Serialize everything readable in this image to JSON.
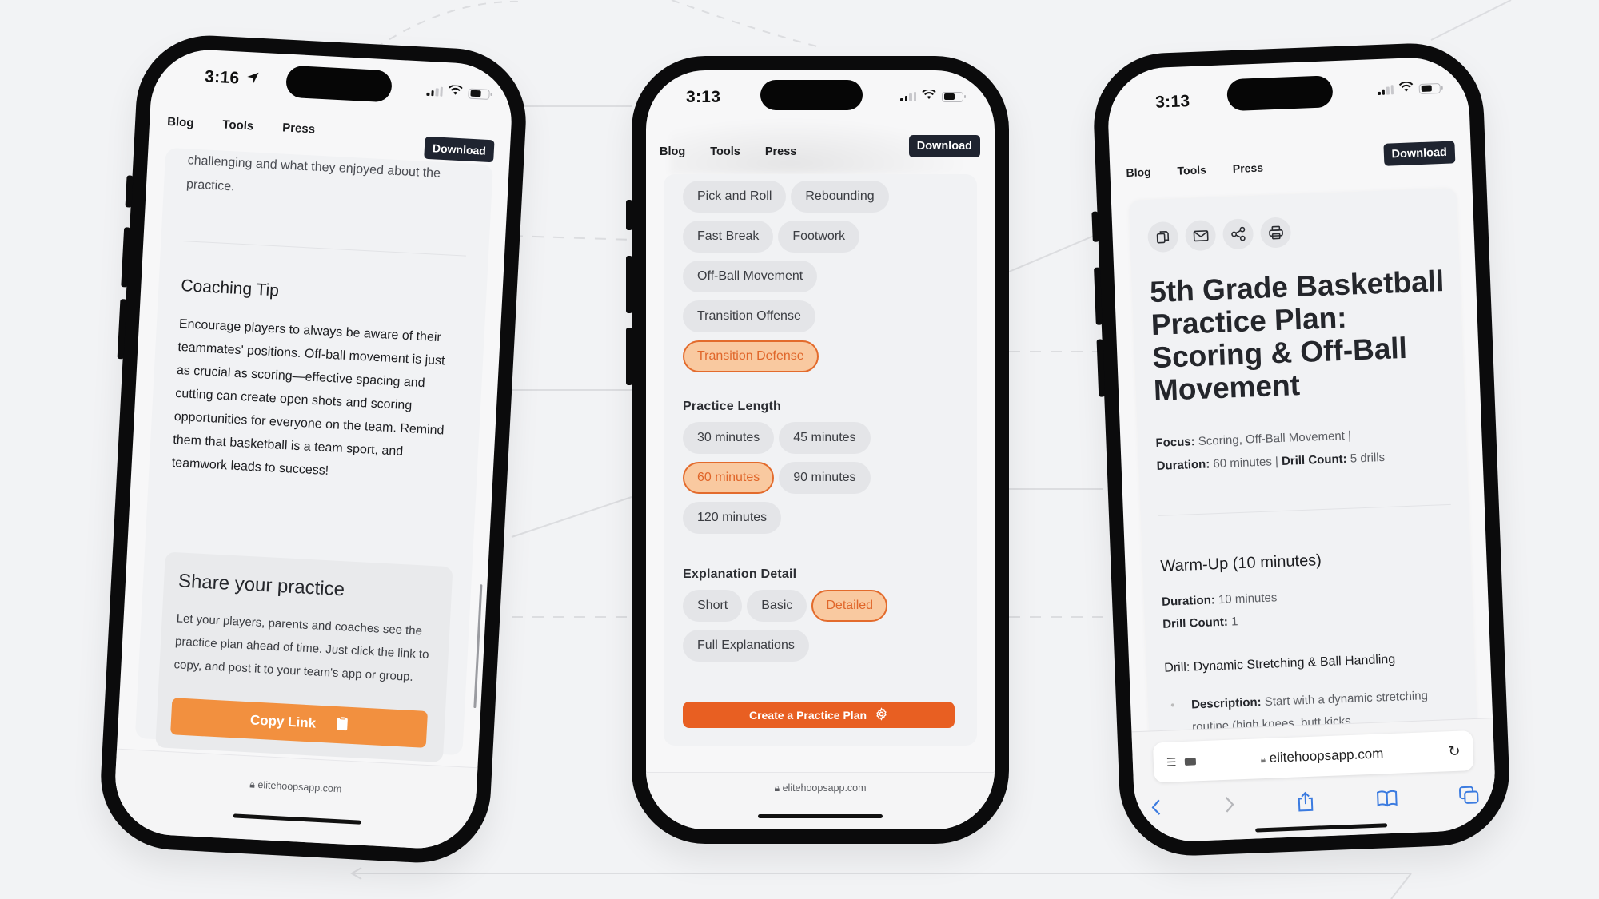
{
  "colors": {
    "accent_orange": "#e85f22",
    "copy_orange": "#f2903f",
    "chip_selected_bg": "#f9c9a0",
    "chip_selected_text": "#e0662a",
    "dark_button": "#1f2430",
    "ios_blue": "#3b7be0"
  },
  "nav": {
    "blog": "Blog",
    "tools": "Tools",
    "press": "Press",
    "download": "Download"
  },
  "url": "elitehoopsapp.com",
  "phone_left": {
    "time": "3:16",
    "location_icon": "location-arrow-icon",
    "intro_text": "challenging and what they enjoyed about the practice.",
    "coaching_tip": {
      "title": "Coaching Tip",
      "body": "Encourage players to always be aware of their teammates' positions. Off-ball movement is just as crucial as scoring—effective spacing and cutting can create open shots and scoring opportunities for everyone on the team. Remind them that basketball is a team sport, and teamwork leads to success!"
    },
    "share": {
      "title": "Share your practice",
      "body": "Let your players, parents and coaches see the practice plan ahead of time. Just click the link to copy, and post it to your team's app or group.",
      "button": "Copy Link",
      "button_icon": "clipboard-icon"
    }
  },
  "phone_center": {
    "time": "3:13",
    "focus_chips": [
      {
        "label": "Pick and Roll",
        "selected": false
      },
      {
        "label": "Rebounding",
        "selected": false
      },
      {
        "label": "Fast Break",
        "selected": false
      },
      {
        "label": "Footwork",
        "selected": false
      },
      {
        "label": "Off-Ball Movement",
        "selected": false
      },
      {
        "label": "Transition Offense",
        "selected": false
      },
      {
        "label": "Transition Defense",
        "selected": true
      }
    ],
    "practice_length": {
      "label": "Practice Length",
      "options": [
        {
          "label": "30 minutes",
          "selected": false
        },
        {
          "label": "45 minutes",
          "selected": false
        },
        {
          "label": "60 minutes",
          "selected": true
        },
        {
          "label": "90 minutes",
          "selected": false
        },
        {
          "label": "120 minutes",
          "selected": false
        }
      ]
    },
    "explanation_detail": {
      "label": "Explanation Detail",
      "options": [
        {
          "label": "Short",
          "selected": false
        },
        {
          "label": "Basic",
          "selected": false
        },
        {
          "label": "Detailed",
          "selected": true
        },
        {
          "label": "Full Explanations",
          "selected": false
        }
      ]
    },
    "create_button": "Create a Practice Plan",
    "create_icon": "gear-icon"
  },
  "phone_right": {
    "time": "3:13",
    "actions": [
      "copy-icon",
      "mail-icon",
      "share-icon",
      "print-icon"
    ],
    "title": "5th Grade Basketball Practice Plan: Scoring & Off-Ball Movement",
    "meta": {
      "focus_label": "Focus:",
      "focus_value": "Scoring, Off-Ball Movement |",
      "duration_label": "Duration:",
      "duration_value": "60 minutes |",
      "drill_count_label": "Drill Count:",
      "drill_count_value": "5 drills"
    },
    "section": {
      "title": "Warm-Up (10 minutes)",
      "duration_label": "Duration:",
      "duration_value": "10 minutes",
      "drill_count_label": "Drill Count:",
      "drill_count_value": "1",
      "drill_title": "Drill: Dynamic Stretching & Ball Handling",
      "desc_label": "Description:",
      "desc_value": "Start with a dynamic stretching routine (high knees, butt kicks,"
    },
    "safari": {
      "url": "elitehoopsapp.com",
      "toolbar": [
        "back-icon",
        "forward-icon",
        "share-icon",
        "bookmarks-icon",
        "tabs-icon"
      ]
    }
  }
}
